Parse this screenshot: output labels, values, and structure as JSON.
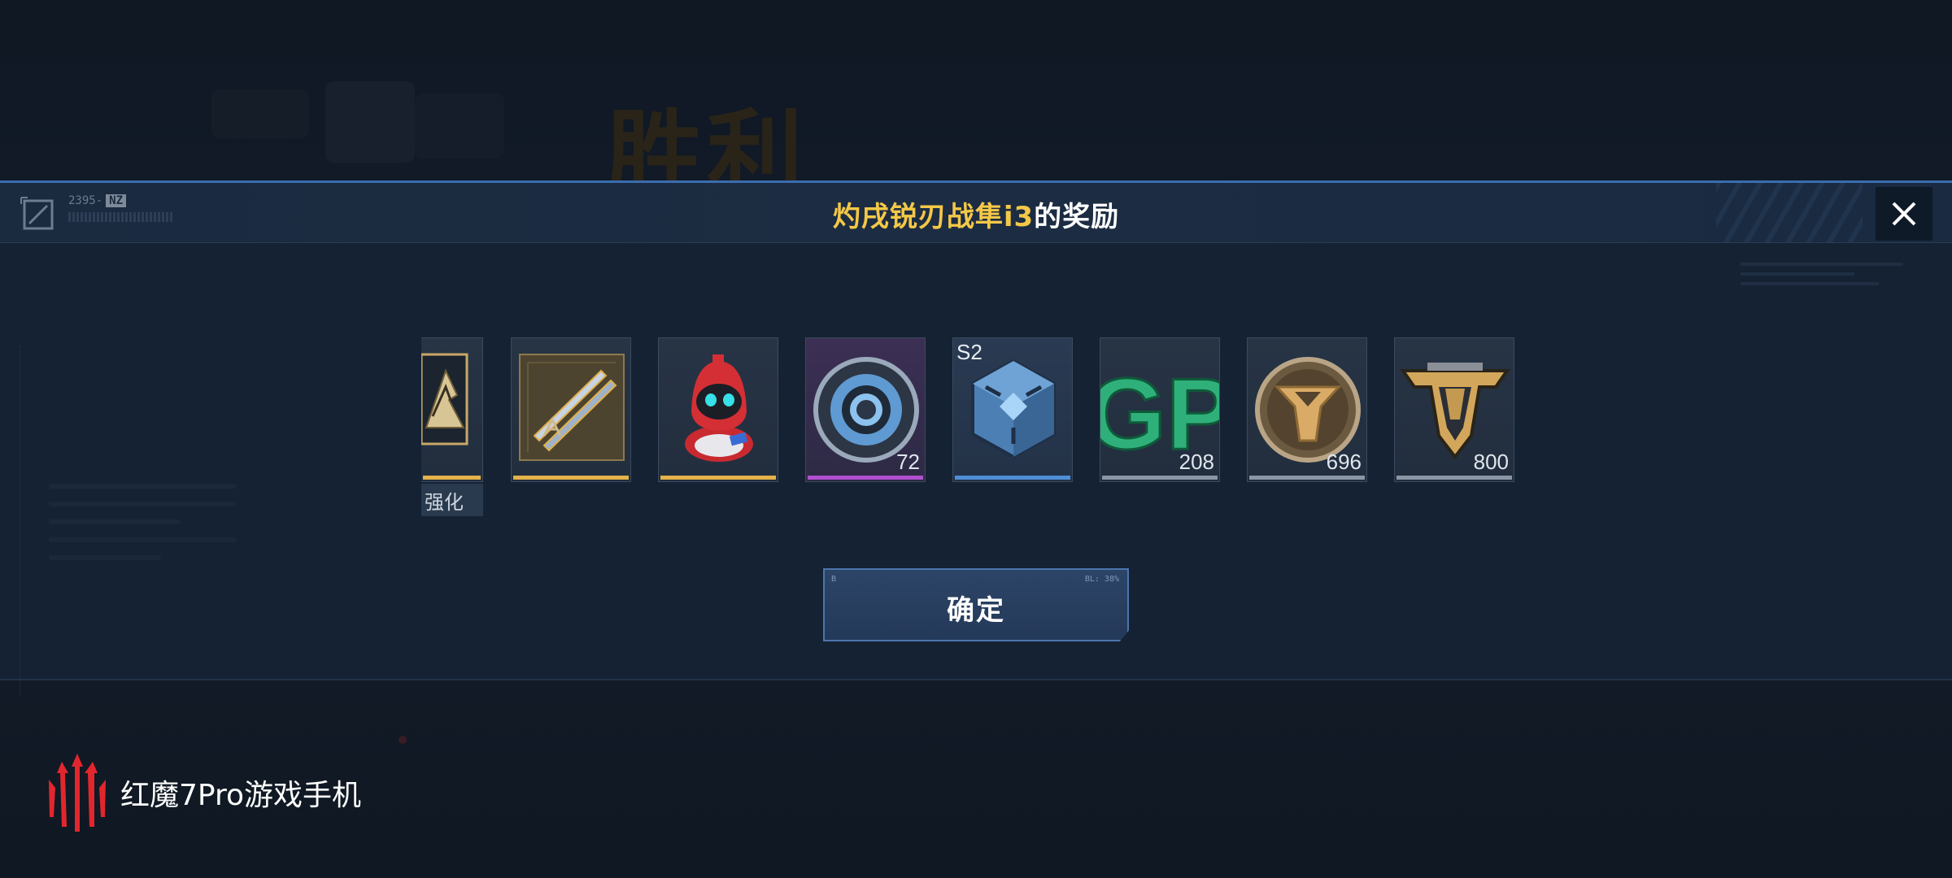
{
  "background": {
    "victory_text": "胜利"
  },
  "dialog": {
    "header_code": "2395-",
    "header_tag": "NZ",
    "title_highlight": "灼戌锐刃战隼i3",
    "title_suffix": "的奖励",
    "close_icon": "close-icon",
    "confirm_label": "确定",
    "confirm_mini_left": "B",
    "confirm_mini_right": "BL: 38%"
  },
  "rewards": [
    {
      "name": "enhance-item",
      "icon": "pyramid-arrow-icon",
      "label": "强化",
      "count": "",
      "rarity_color": "#e3b24a",
      "clipped": true
    },
    {
      "name": "blade-blueprint",
      "icon": "twin-blades-icon",
      "count": "",
      "rarity_color": "#e3b24a"
    },
    {
      "name": "robot-pet",
      "icon": "red-robot-icon",
      "count": "",
      "rarity_color": "#e3b24a"
    },
    {
      "name": "ring-token",
      "icon": "ring-icon",
      "count": "72",
      "rarity_color": "#b04fd0"
    },
    {
      "name": "season-crate",
      "icon": "cube-crate-icon",
      "season": "S2",
      "count": "",
      "rarity_color": "#4e8ed6"
    },
    {
      "name": "gp-currency",
      "icon": "gp-icon",
      "count": "208",
      "rarity_color": "#8a96a4"
    },
    {
      "name": "medal-coin",
      "icon": "medal-coin-icon",
      "count": "696",
      "rarity_color": "#8a96a4"
    },
    {
      "name": "emblem-badge",
      "icon": "emblem-icon",
      "count": "800",
      "rarity_color": "#8a96a4"
    }
  ],
  "brand": {
    "text": "红魔7Pro游戏手机",
    "logo": "red-magic-logo-icon"
  }
}
